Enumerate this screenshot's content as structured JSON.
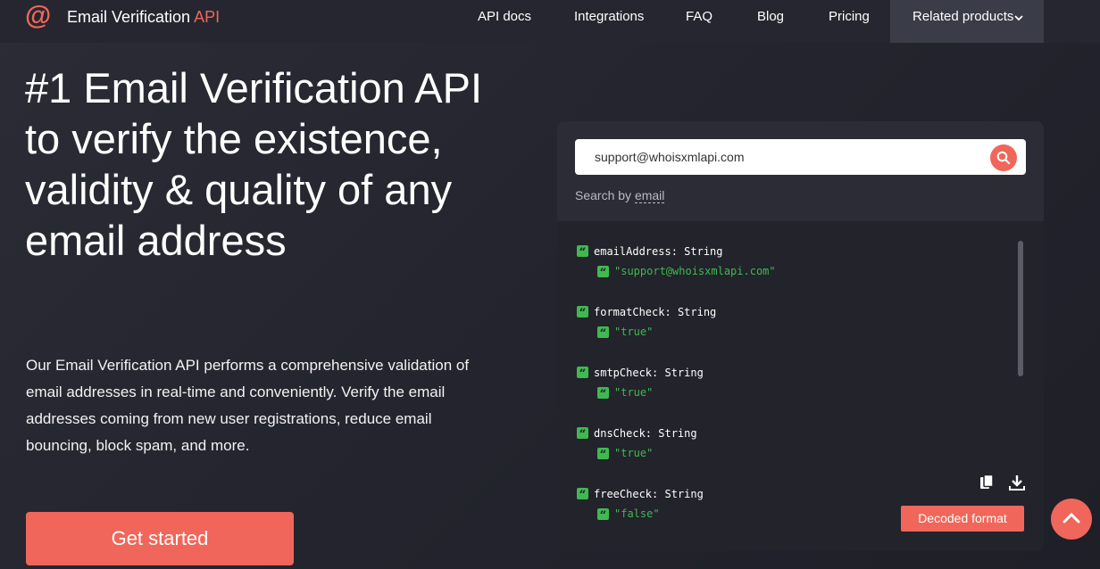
{
  "header": {
    "logo_icon": "at-sign-icon",
    "logo_glyph": "@",
    "brand_main": "Email Verification",
    "brand_accent": "API",
    "nav": [
      {
        "label": "API docs"
      },
      {
        "label": "Integrations"
      },
      {
        "label": "FAQ"
      },
      {
        "label": "Blog"
      },
      {
        "label": "Pricing"
      }
    ],
    "related": {
      "label": "Related products",
      "icon": "chevron-down-icon"
    }
  },
  "hero": {
    "title": "#1 Email Verification API to verify the existence, validity & quality of any email address",
    "description": "Our Email Verification API performs a comprehensive validation of email addresses in real-time and conveniently. Verify the email addresses coming from new user registrations, reduce email bouncing, block spam, and more.",
    "cta_label": "Get started"
  },
  "demo": {
    "search_value": "support@whoisxmlapi.com",
    "search_icon": "search-icon",
    "search_by_prefix": "Search by",
    "search_by_link": "email",
    "fields": [
      {
        "name": "emailAddress",
        "type": "String",
        "value": "\"support@whoisxmlapi.com\""
      },
      {
        "name": "formatCheck",
        "type": "String",
        "value": "\"true\""
      },
      {
        "name": "smtpCheck",
        "type": "String",
        "value": "\"true\""
      },
      {
        "name": "dnsCheck",
        "type": "String",
        "value": "\"true\""
      },
      {
        "name": "freeCheck",
        "type": "String",
        "value": "\"false\""
      }
    ],
    "field_separator": ": ",
    "quote_glyph": "“",
    "copy_icon": "copy-icon",
    "download_icon": "download-icon",
    "decoded_label": "Decoded format"
  },
  "scroll_top_icon": "chevron-up-icon",
  "colors": {
    "accent": "#f0665a",
    "background": "#24252e",
    "panel": "#22232b",
    "value_green": "#3fb950"
  }
}
